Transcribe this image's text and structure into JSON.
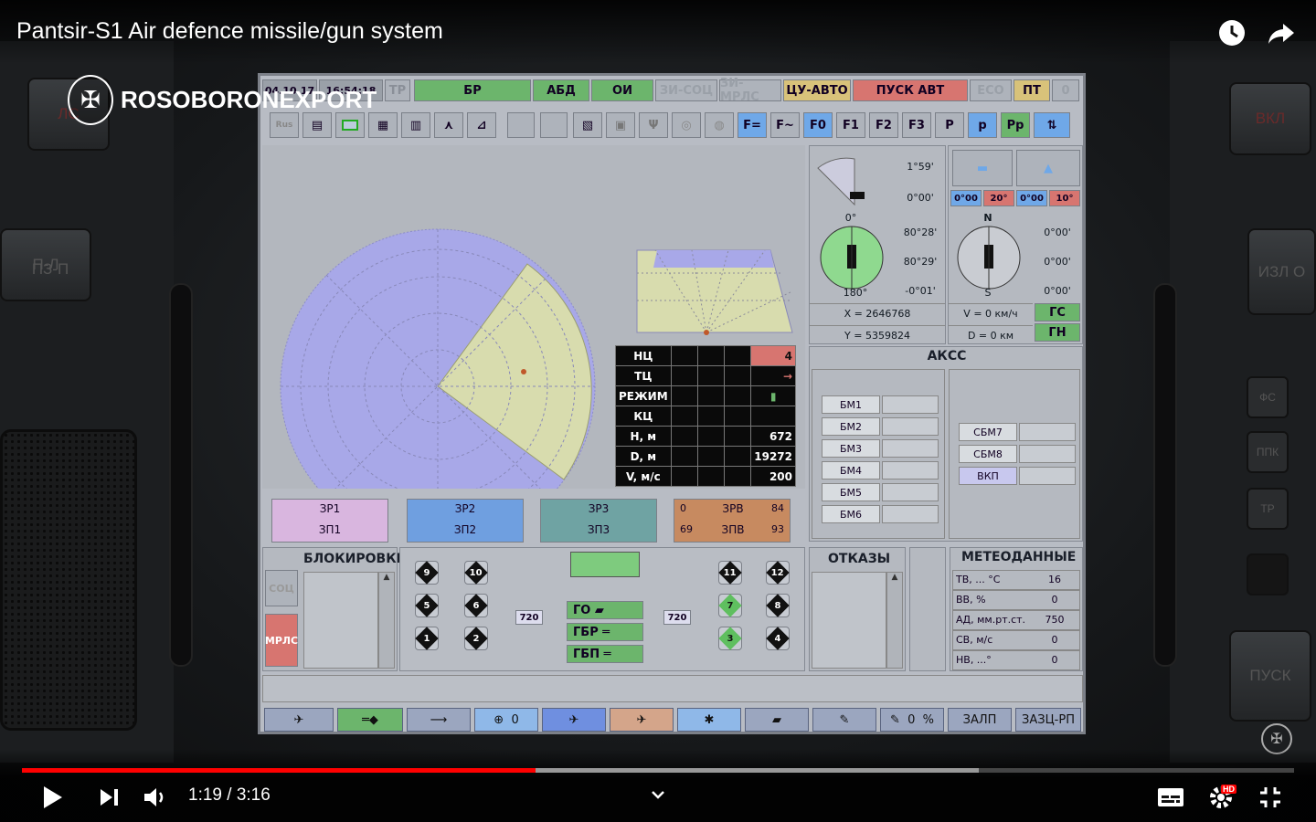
{
  "video": {
    "title": "Pantsir-S1 Air defence missile/gun system",
    "time_current": "1:19",
    "time_separator": " / ",
    "time_total": "3:16",
    "progress_played": 0.404,
    "progress_buffered": 0.752,
    "hd_badge": "HD"
  },
  "brand": {
    "name": "ROSOBORONEXPORT"
  },
  "hardware": {
    "left_buttons": [
      "ЛС",
      "П-Л",
      "ПЗ-П"
    ],
    "right_buttons": [
      "ВКЛ",
      "ИЗЛ О",
      "ПУСК"
    ],
    "right_small": [
      "ФС",
      "ППК",
      "ТР",
      ""
    ]
  },
  "screen": {
    "status_bar": {
      "date": "04.10.17",
      "time": "16:54:18",
      "tp": "ТР",
      "modes": [
        "БР",
        "АБД",
        "ОИ",
        "ЗИ-СОЦ",
        "ЗИ-МРЛС",
        "ЦУ-АВТО",
        "ПУСК АВТ",
        "ЕСО",
        "ПТ",
        "0"
      ]
    },
    "toolbar": {
      "f_buttons": [
        "F=",
        "F~",
        "F0",
        "F1",
        "F2",
        "F3",
        "P",
        "p",
        "Pp"
      ]
    },
    "orientation": {
      "angle1": "1°59'",
      "angle2": "0°00'",
      "compass1_top": "0°",
      "compass1_bottom": "180°",
      "c1_v1": "80°28'",
      "c1_v2": "80°29'",
      "c1_v3": "-0°01'",
      "x_coord": "X = 2646768",
      "y_coord": "Y = 5359824",
      "tilt_vals": [
        "0°00",
        "20°",
        "0°00",
        "10°"
      ],
      "compass2_top": "N",
      "compass2_bottom": "S",
      "c2_v1": "0°00'",
      "c2_v2": "0°00'",
      "c2_v3": "0°00'",
      "speed": "V = 0 км/ч",
      "distance": "D = 0 км",
      "gs": "ГС",
      "gn": "ГН"
    },
    "target_table": {
      "rows": [
        {
          "label": "НЦ",
          "value": "4"
        },
        {
          "label": "ТЦ",
          "value": "→"
        },
        {
          "label": "РЕЖИМ",
          "value": "▮"
        },
        {
          "label": "КЦ",
          "value": ""
        },
        {
          "label": "Н, м",
          "value": "672"
        },
        {
          "label": "D, м",
          "value": "19272"
        },
        {
          "label": "V, м/с",
          "value": "200"
        }
      ]
    },
    "akss": {
      "title": "АКСС",
      "bm": [
        "БМ1",
        "БМ2",
        "БМ3",
        "БМ4",
        "БМ5",
        "БМ6"
      ],
      "sbm": [
        "СБМ7",
        "СБМ8",
        "ВКП"
      ]
    },
    "zr": [
      {
        "top": "ЗР1",
        "bottom": "ЗП1",
        "color": "#d9b6df"
      },
      {
        "top": "ЗР2",
        "bottom": "ЗП2",
        "color": "#6f9fe0"
      },
      {
        "top": "ЗР3",
        "bottom": "ЗП3",
        "color": "#6fa3a3"
      }
    ],
    "ammo": {
      "top_left": "0",
      "top_label": "ЗРВ",
      "top_right": "84",
      "bottom_left": "69",
      "bottom_label": "ЗПВ",
      "bottom_right": "93"
    },
    "blocks": {
      "title": "БЛОКИРОВКИ",
      "soc": "СОЦ",
      "mrls": "МРЛС"
    },
    "launchers": {
      "left_a": [
        "9",
        "5",
        "1"
      ],
      "left_b": [
        "10",
        "6",
        "2"
      ],
      "right_a": [
        "11",
        "7",
        "3"
      ],
      "right_b": [
        "12",
        "8",
        "4"
      ],
      "count_left": "720",
      "count_right": "720",
      "center": [
        "ГО",
        "ГБР",
        "ГБП"
      ]
    },
    "failures": {
      "title": "ОТКАЗЫ"
    },
    "meteo": {
      "title": "МЕТЕОДАННЫЕ",
      "rows": [
        {
          "label": "ТВ, ... °С",
          "value": "16"
        },
        {
          "label": "ВВ, %",
          "value": "0"
        },
        {
          "label": "АД, мм.рт.ст.",
          "value": "750"
        },
        {
          "label": "СВ, м/с",
          "value": "0"
        },
        {
          "label": "НВ, ...°",
          "value": "0"
        }
      ]
    },
    "bottom_bar": {
      "count1": "0",
      "count2": "0",
      "percent": "%",
      "zalp": "ЗАЛП",
      "zazc": "ЗАЗЦ-РП"
    }
  },
  "colors": {
    "radar_blue": "#a8a8e8",
    "radar_sector": "#d8dcae",
    "green_mode": "#6cb56c",
    "red_mode": "#d77570",
    "yellow_mode": "#d8c27a",
    "youtube_red": "#ff0000"
  }
}
